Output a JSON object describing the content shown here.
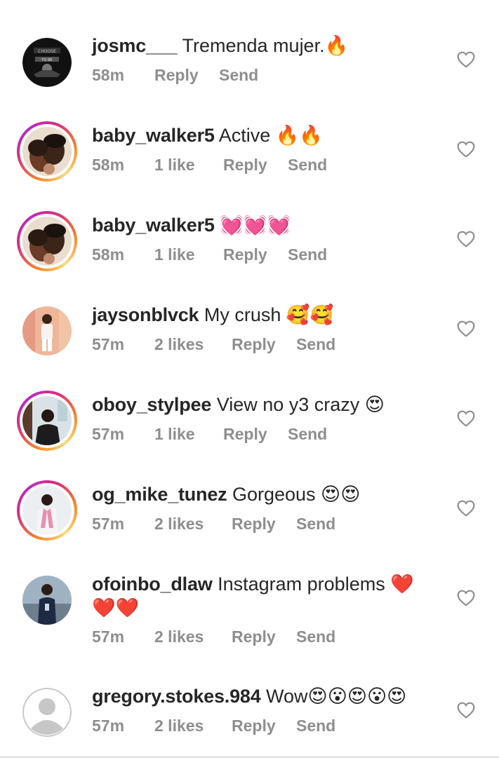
{
  "comments": [
    {
      "username": "josmc___",
      "text": "Tremenda mujer.🔥",
      "time": "58m",
      "likes": "",
      "reply": "Reply",
      "send": "Send",
      "avatar": "dark-logo",
      "story": false
    },
    {
      "username": "baby_walker5",
      "text": "Active 🔥🔥",
      "time": "58m",
      "likes": "1 like",
      "reply": "Reply",
      "send": "Send",
      "avatar": "couple-photo",
      "story": true
    },
    {
      "username": "baby_walker5",
      "text": "💓💓💓",
      "time": "58m",
      "likes": "1 like",
      "reply": "Reply",
      "send": "Send",
      "avatar": "couple-photo",
      "story": true
    },
    {
      "username": "jaysonblvck",
      "text": "My crush 🥰🥰",
      "time": "57m",
      "likes": "2 likes",
      "reply": "Reply",
      "send": "Send",
      "avatar": "person-pink-bg",
      "story": false
    },
    {
      "username": "oboy_stylpee",
      "text": "View no y3 crazy 😍",
      "time": "57m",
      "likes": "1 like",
      "reply": "Reply",
      "send": "Send",
      "avatar": "barbershop-photo",
      "story": true
    },
    {
      "username": "og_mike_tunez",
      "text": "Gorgeous 😍😍",
      "time": "57m",
      "likes": "2 likes",
      "reply": "Reply",
      "send": "Send",
      "avatar": "person-white-outfit",
      "story": true
    },
    {
      "username": "ofoinbo_dlaw",
      "text": "Instagram problems ❤️",
      "text2": "❤️❤️",
      "time": "57m",
      "likes": "2 likes",
      "reply": "Reply",
      "send": "Send",
      "avatar": "person-outdoor",
      "story": false
    },
    {
      "username": "gregory.stokes.984",
      "text": "Wow😍😮😍😮😍",
      "time": "57m",
      "likes": "2 likes",
      "reply": "Reply",
      "send": "Send",
      "avatar": "default-avatar",
      "story": false
    }
  ],
  "icons": {
    "like": "heart-outline-icon"
  },
  "colors": {
    "text": "#262626",
    "meta": "#8e8e8e",
    "story_ring_start": "#f58529",
    "story_ring_end": "#dd2a7b"
  }
}
